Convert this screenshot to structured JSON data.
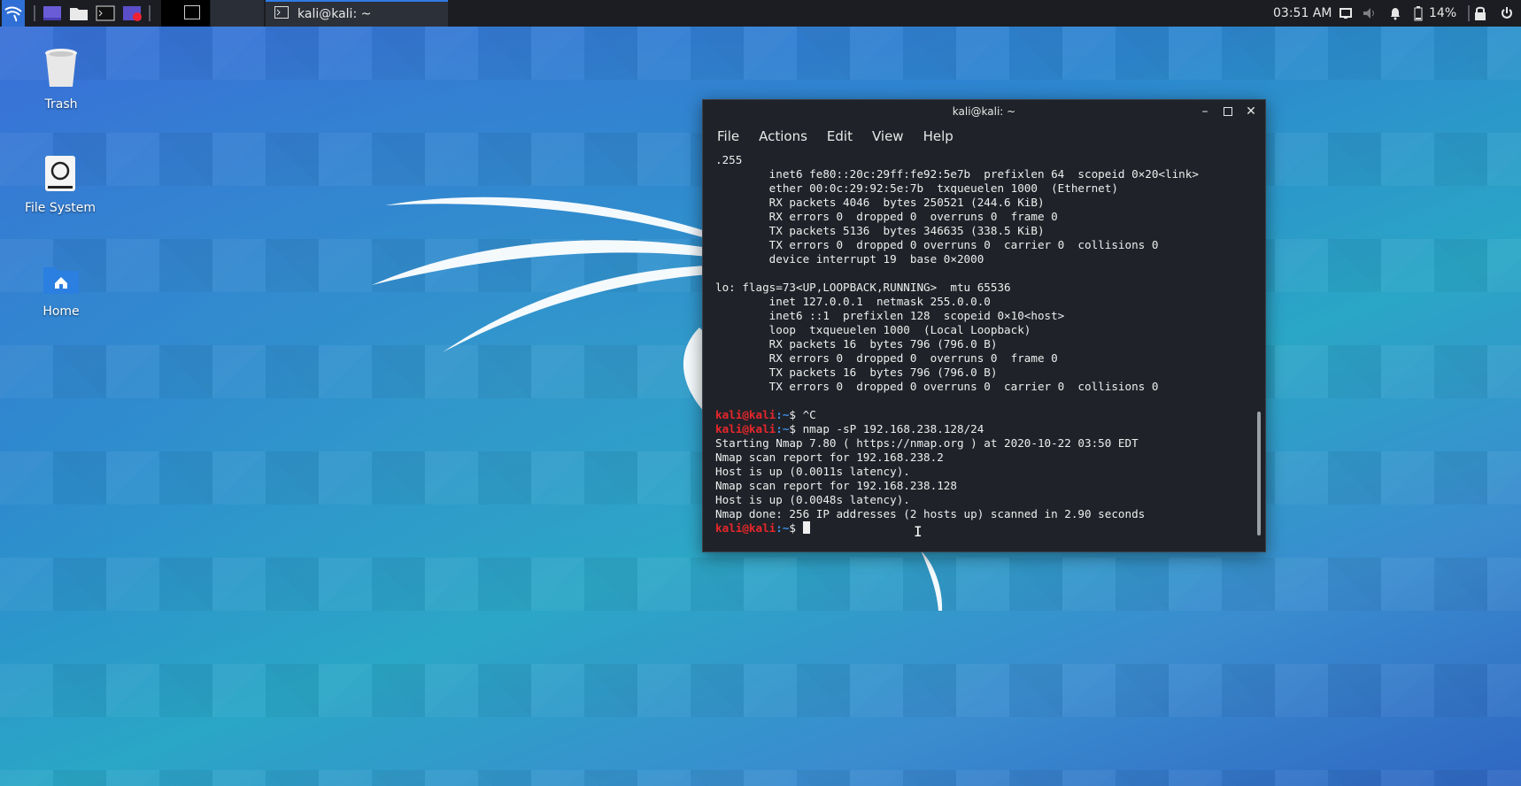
{
  "panel": {
    "clock": "03:51 AM",
    "battery": "14%",
    "task_title": "kali@kali: ~"
  },
  "desktop": {
    "icons": [
      {
        "label": "Trash",
        "icon": "trash-icon"
      },
      {
        "label": "File System",
        "icon": "drive-icon"
      },
      {
        "label": "Home",
        "icon": "home-folder-icon"
      }
    ]
  },
  "window": {
    "title": "kali@kali: ~",
    "menu": [
      "File",
      "Actions",
      "Edit",
      "View",
      "Help"
    ]
  },
  "terminal": {
    "prompt_user": "kali@kali",
    "prompt_path": ":~",
    "prompt_end": "$ ",
    "lines": [
      {
        "type": "out",
        "text": ".255"
      },
      {
        "type": "out",
        "text": "        inet6 fe80::20c:29ff:fe92:5e7b  prefixlen 64  scopeid 0×20<link>"
      },
      {
        "type": "out",
        "text": "        ether 00:0c:29:92:5e:7b  txqueuelen 1000  (Ethernet)"
      },
      {
        "type": "out",
        "text": "        RX packets 4046  bytes 250521 (244.6 KiB)"
      },
      {
        "type": "out",
        "text": "        RX errors 0  dropped 0  overruns 0  frame 0"
      },
      {
        "type": "out",
        "text": "        TX packets 5136  bytes 346635 (338.5 KiB)"
      },
      {
        "type": "out",
        "text": "        TX errors 0  dropped 0 overruns 0  carrier 0  collisions 0"
      },
      {
        "type": "out",
        "text": "        device interrupt 19  base 0×2000"
      },
      {
        "type": "out",
        "text": ""
      },
      {
        "type": "out",
        "text": "lo: flags=73<UP,LOOPBACK,RUNNING>  mtu 65536"
      },
      {
        "type": "out",
        "text": "        inet 127.0.0.1  netmask 255.0.0.0"
      },
      {
        "type": "out",
        "text": "        inet6 ::1  prefixlen 128  scopeid 0×10<host>"
      },
      {
        "type": "out",
        "text": "        loop  txqueuelen 1000  (Local Loopback)"
      },
      {
        "type": "out",
        "text": "        RX packets 16  bytes 796 (796.0 B)"
      },
      {
        "type": "out",
        "text": "        RX errors 0  dropped 0  overruns 0  frame 0"
      },
      {
        "type": "out",
        "text": "        TX packets 16  bytes 796 (796.0 B)"
      },
      {
        "type": "out",
        "text": "        TX errors 0  dropped 0 overruns 0  carrier 0  collisions 0"
      },
      {
        "type": "out",
        "text": ""
      },
      {
        "type": "cmd",
        "text": "^C"
      },
      {
        "type": "cmd",
        "text": "nmap -sP 192.168.238.128/24"
      },
      {
        "type": "out",
        "text": "Starting Nmap 7.80 ( https://nmap.org ) at 2020-10-22 03:50 EDT"
      },
      {
        "type": "out",
        "text": "Nmap scan report for 192.168.238.2"
      },
      {
        "type": "out",
        "text": "Host is up (0.0011s latency)."
      },
      {
        "type": "out",
        "text": "Nmap scan report for 192.168.238.128"
      },
      {
        "type": "out",
        "text": "Host is up (0.0048s latency)."
      },
      {
        "type": "out",
        "text": "Nmap done: 256 IP addresses (2 hosts up) scanned in 2.90 seconds"
      },
      {
        "type": "cursor",
        "text": ""
      }
    ]
  }
}
